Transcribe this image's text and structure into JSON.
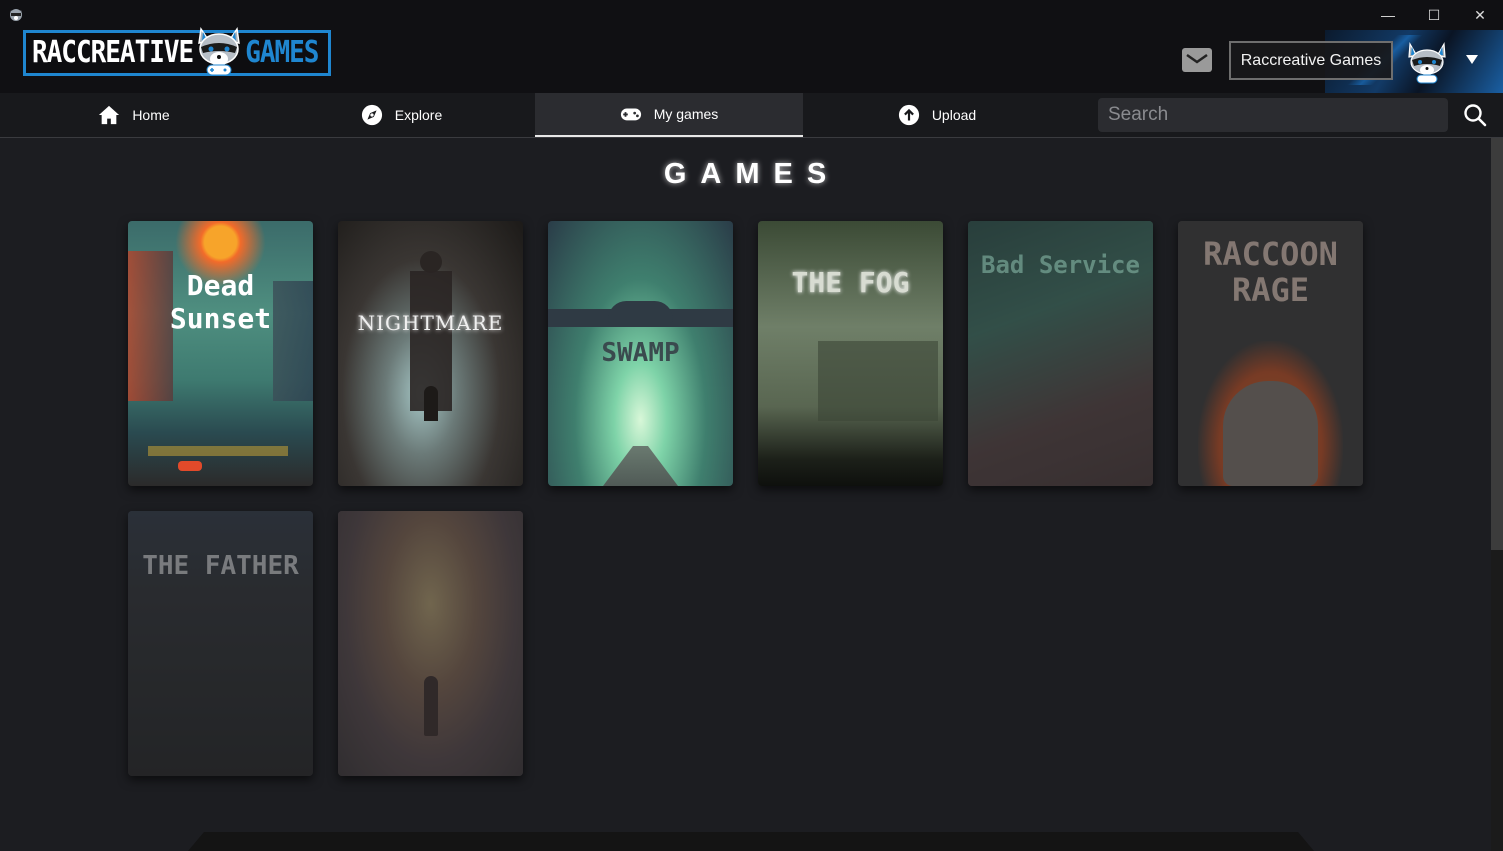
{
  "window": {
    "app_icon": "raccoon-icon",
    "controls": {
      "minimize": "—",
      "maximize": "☐",
      "close": "✕"
    }
  },
  "header": {
    "logo": {
      "left": "RACCREATIVE",
      "right": "GAMES"
    },
    "mail_icon": "mail-icon",
    "user_name": "Raccreative Games",
    "dropdown_icon": "caret-down-icon"
  },
  "nav": {
    "items": [
      {
        "label": "Home",
        "icon": "home-icon",
        "active": false
      },
      {
        "label": "Explore",
        "icon": "compass-icon",
        "active": false
      },
      {
        "label": "My games",
        "icon": "gamepad-icon",
        "active": true
      },
      {
        "label": "Upload",
        "icon": "upload-icon",
        "active": false
      }
    ],
    "search": {
      "placeholder": "Search",
      "value": ""
    }
  },
  "main": {
    "title": "GAMES",
    "games": [
      {
        "title": "Dead Sunset",
        "title_line1": "Dead",
        "title_line2": "Sunset",
        "dimmed": false
      },
      {
        "title": "NIGHTMARE",
        "dimmed": false
      },
      {
        "title": "SWAMP",
        "dimmed": false
      },
      {
        "title": "THE FOG",
        "dimmed": false
      },
      {
        "title": "Bad Service",
        "dimmed": true
      },
      {
        "title": "RACCOON RAGE",
        "title_line1": "RACCOON",
        "title_line2": "RAGE",
        "dimmed": true
      },
      {
        "title": "THE FATHER",
        "dimmed": true
      },
      {
        "title": "",
        "dimmed": true
      }
    ]
  }
}
